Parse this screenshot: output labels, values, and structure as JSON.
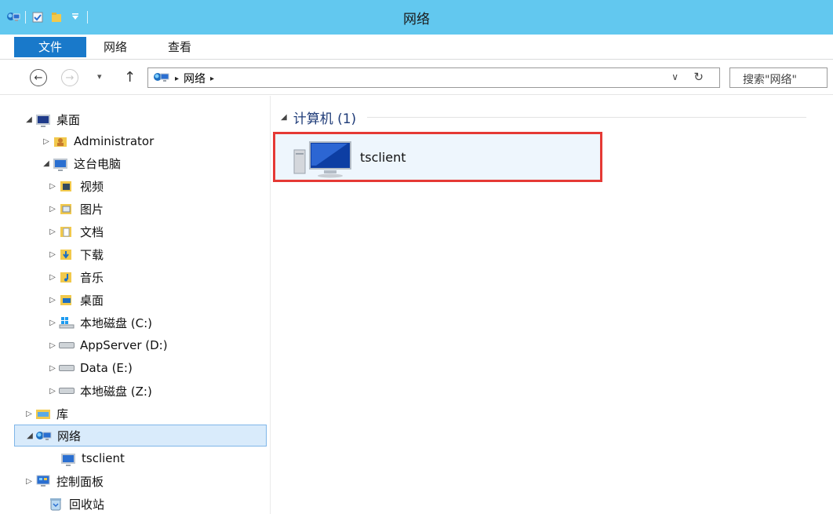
{
  "window": {
    "title": "网络"
  },
  "quick_access_toolbar": {
    "icons": [
      "network-icon",
      "properties-icon",
      "new-folder-icon",
      "dropdown-icon"
    ]
  },
  "ribbon": {
    "tabs": [
      {
        "label": "文件",
        "active": true
      },
      {
        "label": "网络"
      },
      {
        "label": "查看"
      }
    ]
  },
  "address_bar": {
    "back_glyph": "←",
    "forward_glyph": "→",
    "recent_glyph": "▾",
    "up_glyph": "↑",
    "crumb_arrow": "▸",
    "breadcrumb": [
      "网络"
    ],
    "dropdown_glyph": "∨",
    "refresh_glyph": "↻"
  },
  "search": {
    "placeholder": "搜索\"网络\""
  },
  "nav_tree": {
    "expanded_glyph": "◢",
    "collapsed_glyph": "▷",
    "items": [
      {
        "label": "桌面",
        "icon": "desktop-icon"
      },
      {
        "label": "Administrator",
        "icon": "user-folder-icon"
      },
      {
        "label": "这台电脑",
        "icon": "computer-icon"
      },
      {
        "label": "视频",
        "icon": "videos-icon"
      },
      {
        "label": "图片",
        "icon": "pictures-icon"
      },
      {
        "label": "文档",
        "icon": "documents-icon"
      },
      {
        "label": "下载",
        "icon": "downloads-icon"
      },
      {
        "label": "音乐",
        "icon": "music-icon"
      },
      {
        "label": "桌面",
        "icon": "desktop-folder-icon"
      },
      {
        "label": "本地磁盘 (C:)",
        "icon": "windows-drive-icon"
      },
      {
        "label": "AppServer (D:)",
        "icon": "drive-icon"
      },
      {
        "label": "Data (E:)",
        "icon": "drive-icon"
      },
      {
        "label": "本地磁盘 (Z:)",
        "icon": "drive-icon"
      },
      {
        "label": "库",
        "icon": "libraries-icon"
      },
      {
        "label": "网络",
        "icon": "network-icon",
        "selected": true
      },
      {
        "label": "tsclient",
        "icon": "computer-icon"
      },
      {
        "label": "控制面板",
        "icon": "control-panel-icon"
      },
      {
        "label": "回收站",
        "icon": "recycle-bin-icon"
      }
    ]
  },
  "content": {
    "group_header": "计算机 (1)",
    "items": [
      {
        "label": "tsclient",
        "icon": "network-computer-icon",
        "highlighted": true
      }
    ]
  },
  "colors": {
    "title_bar": "#62c8ef",
    "file_tab": "#1979ca",
    "highlight_border": "#e53935",
    "selected_bg": "#d9ebfb"
  }
}
